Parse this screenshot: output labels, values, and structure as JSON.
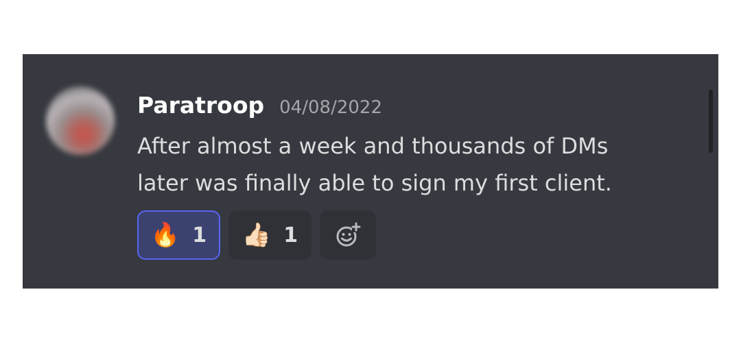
{
  "message": {
    "username": "Paratroop",
    "timestamp": "04/08/2022",
    "text": "After almost a week and thousands of DMs\nlater was finally able to sign my first client.",
    "reactions": [
      {
        "emoji": "🔥",
        "count": "1",
        "selected": true
      },
      {
        "emoji": "👍🏻",
        "count": "1",
        "selected": false
      }
    ],
    "add_reaction_icon": "add-reaction-smiley-icon"
  },
  "colors": {
    "background": "#36393f",
    "username": "#ffffff",
    "timestamp": "#a3a6aa",
    "text": "#dcddde",
    "reaction_bg": "#2f3136",
    "reaction_selected_bg": "#3c4270",
    "reaction_selected_border": "#5865f2"
  }
}
